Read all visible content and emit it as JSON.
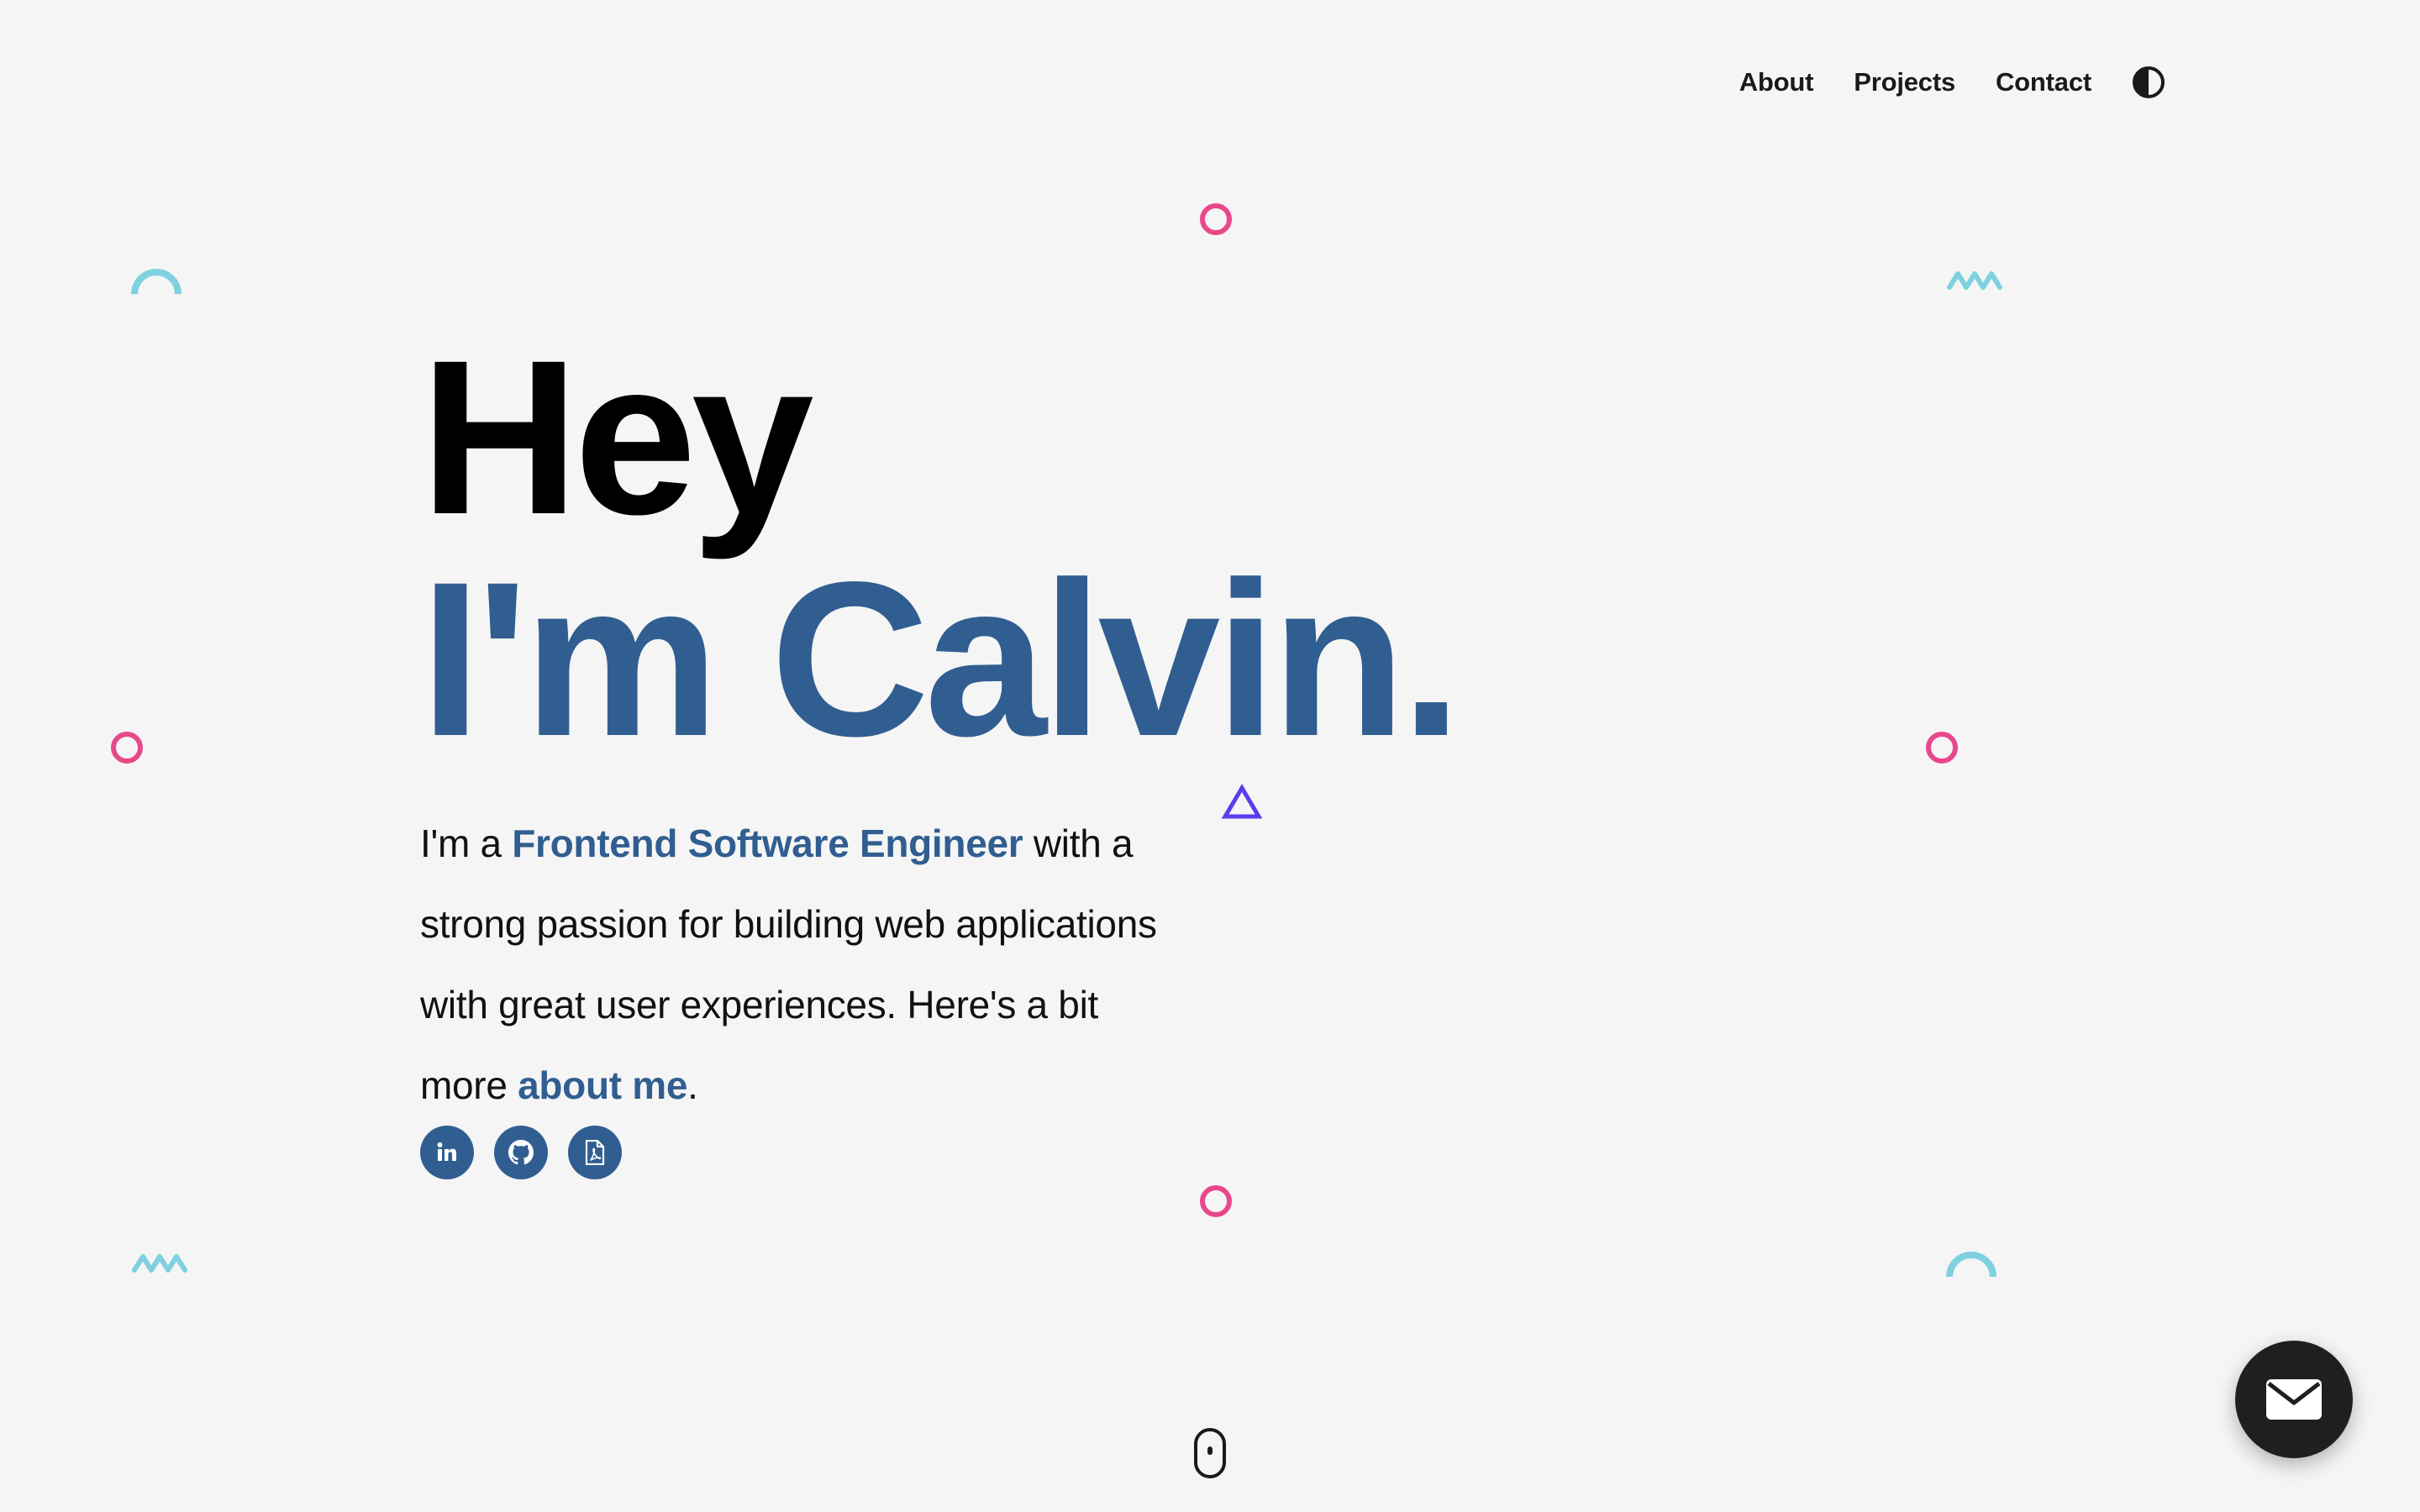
{
  "nav": {
    "items": [
      {
        "label": "About"
      },
      {
        "label": "Projects"
      },
      {
        "label": "Contact"
      }
    ],
    "theme_toggle_icon": "contrast-icon"
  },
  "hero": {
    "greeting": "Hey",
    "name": "I'm Calvin.",
    "bio": {
      "prefix": "I'm a ",
      "role": "Frontend Software Engineer",
      "middle": " with a strong passion for building web applications with great user experiences. Here's a bit more ",
      "link": "about me",
      "suffix": "."
    }
  },
  "socials": [
    {
      "name": "linkedin",
      "icon": "linkedin-icon",
      "glyph": "in"
    },
    {
      "name": "github",
      "icon": "github-icon"
    },
    {
      "name": "resume",
      "icon": "pdf-icon"
    }
  ],
  "fab": {
    "icon": "mail-icon"
  },
  "scroll_indicator": {
    "icon": "mouse-icon"
  },
  "colors": {
    "background": "#f5f5f5",
    "accent": "#315e91",
    "text": "#000000",
    "deco_pink": "#e8488a",
    "deco_cyan": "#7fd1e0",
    "deco_purple": "#5b3cf0"
  }
}
